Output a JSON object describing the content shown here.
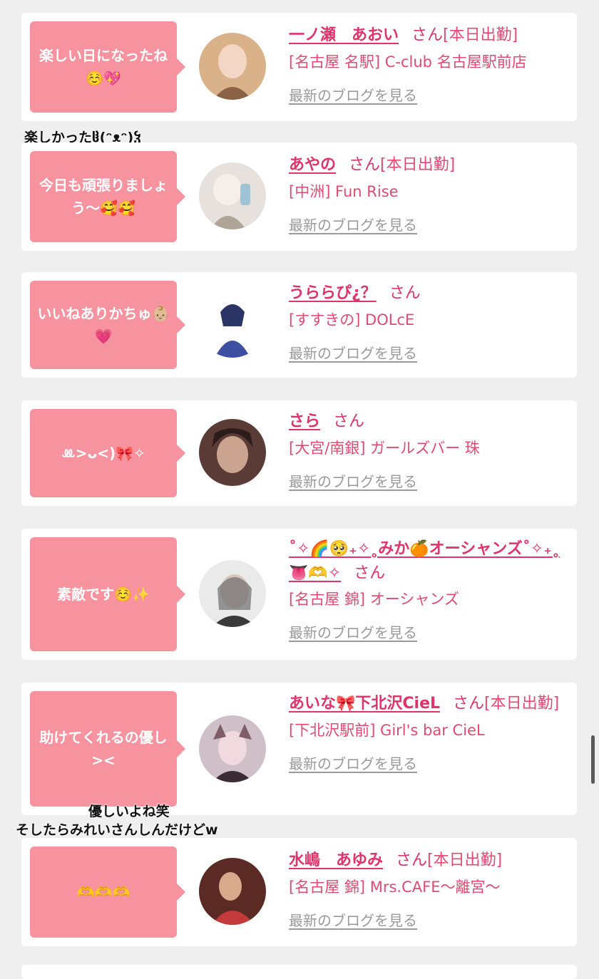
{
  "cards": [
    {
      "comment": "楽しい日になったね☺️💖",
      "name": "一ノ瀬　あおい",
      "san": "さん",
      "status": "[本日出勤]",
      "shop": "[名古屋 名駅] C-club 名古屋駅前店",
      "blog_link": "最新のブログを見る",
      "avatar_colors": [
        "#d9b28a",
        "#f3d7c4",
        "#8a6347"
      ]
    },
    {
      "comment": "今日も頑張りましょう〜🥰🥰",
      "name": "あやの",
      "san": "さん",
      "status": "[本日出勤]",
      "shop": "[中洲] Fun Rise",
      "blog_link": "最新のブログを見る",
      "avatar_colors": [
        "#e6e1dc",
        "#f6efe9",
        "#b0a497"
      ]
    },
    {
      "comment": "いいねありかちゅ👶🏼💗",
      "name": "うららぴ¿？",
      "san": "さん",
      "status": "",
      "shop": "[すすきの] DOLcE",
      "blog_link": "最新のブログを見る",
      "avatar_colors": [
        "#ffffff",
        "#2a3566",
        "#3d4fa0"
      ]
    },
    {
      "comment": "ꔛ>ᴗ<)🎀✧",
      "name": "さら",
      "san": "さん",
      "status": "",
      "shop": "[大宮/南銀] ガールズバー 珠",
      "blog_link": "最新のブログを見る",
      "avatar_colors": [
        "#5a3b35",
        "#caa48e",
        "#2d1d1a"
      ]
    },
    {
      "comment": "素敵です☺️✨",
      "name": "˚✧🌈🥺₊✧˳みか🍊オーシャンズ˚✧₊˳👅🫶✧",
      "san": "さん",
      "status": "",
      "shop": "[名古屋 錦] オーシャンズ",
      "blog_link": "最新のブログを見る",
      "avatar_colors": [
        "#eaeaea",
        "#d8c6bb",
        "#6e6e6e"
      ]
    },
    {
      "comment": "助けてくれるの優し><",
      "name": "あいな🎀下北沢CieL",
      "san": "さん",
      "status": "[本日出勤]",
      "shop": "[下北沢駅前] Girl's bar CieL",
      "blog_link": "最新のブログを見る",
      "avatar_colors": [
        "#cfc0c8",
        "#f1dadf",
        "#7c5d68"
      ]
    },
    {
      "comment": "🫶🫶🫶",
      "name": "水嶋　あゆみ",
      "san": "さん",
      "status": "[本日出勤]",
      "shop": "[名古屋 錦] Mrs.CAFE〜離宮〜",
      "blog_link": "最新のブログを見る",
      "avatar_colors": [
        "#5b2a25",
        "#d8aa8c",
        "#c23a3a"
      ]
    }
  ],
  "captions": {
    "first": "楽しかったჱ(ᵔᴥᵔ)ჴ",
    "second": "優しいよね笑",
    "third": "そしたらみれいさんしんだけどw"
  }
}
